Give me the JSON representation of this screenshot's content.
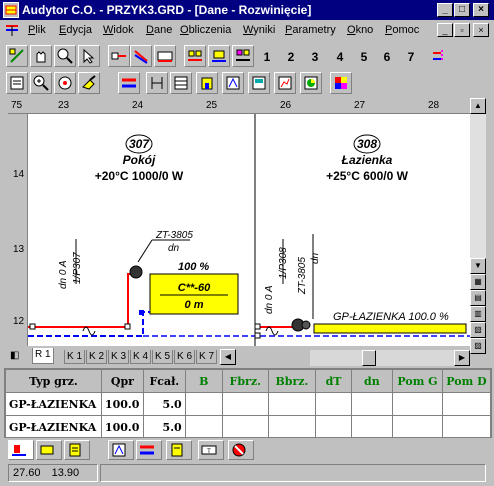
{
  "window": {
    "title": "Audytor C.O. - PRZYK3.GRD - [Dane - Rozwinięcie]",
    "minimize": "_",
    "maximize": "□",
    "close": "×"
  },
  "menu": {
    "items": [
      "Plik",
      "Edycja",
      "Widok",
      "Dane",
      "Obliczenia",
      "Wyniki",
      "Parametry",
      "Okno",
      "Pomoc"
    ],
    "mdi_min": "_",
    "mdi_restore": "▫",
    "mdi_close": "×"
  },
  "toolbar": {
    "numbers": [
      "1",
      "2",
      "3",
      "4",
      "5",
      "6",
      "7"
    ]
  },
  "rulers": {
    "corner": "75",
    "top_ticks": [
      "23",
      "24",
      "25",
      "26",
      "27",
      "28"
    ],
    "left_ticks": [
      "14",
      "13",
      "12"
    ]
  },
  "rooms": [
    {
      "number": "307",
      "name": "Pokój",
      "params": "+20°C 1000/0 W"
    },
    {
      "number": "308",
      "name": "Łazienka",
      "params": "+25°C 600/0 W"
    }
  ],
  "drawing": {
    "riser_left": "1/P307",
    "riser_left_sub": "dn 0 A",
    "riser_right": "1/P308",
    "riser_right_sub": "dn 0 A",
    "valve_left": "ZT-3805",
    "valve_left_sub": "dn",
    "valve_right": "ZT-3805",
    "valve_right_sub": "dn",
    "percent": "100 %",
    "radiator_line1": "C**-60",
    "radiator_line2": "0 m",
    "floor_heater": "GP-ŁAZIENKA 100.0 %"
  },
  "sheet_tabs": [
    "R 1",
    "K 1",
    "K 2",
    "K 3",
    "K 4",
    "K 5",
    "K 6",
    "K 7"
  ],
  "table": {
    "columns": [
      "Typ grz.",
      "Qpr",
      "Fcał.",
      "B",
      "Fbrz.",
      "Bbrz.",
      "dT",
      "dn",
      "Pom G",
      "Pom D"
    ],
    "rows": [
      [
        "GP-ŁAZIENKA",
        "100.0",
        "5.0",
        "",
        "",
        "",
        "",
        "",
        "",
        ""
      ],
      [
        "GP-ŁAZIENKA",
        "100.0",
        "5.0",
        "",
        "",
        "",
        "",
        "",
        "",
        ""
      ]
    ]
  },
  "status": {
    "x": "27.60",
    "y": "13.90"
  },
  "colors": {
    "titlebar": "#000080",
    "pipe_supply": "#ff0000",
    "pipe_return": "#0000ff",
    "radiator": "#ffff00"
  }
}
